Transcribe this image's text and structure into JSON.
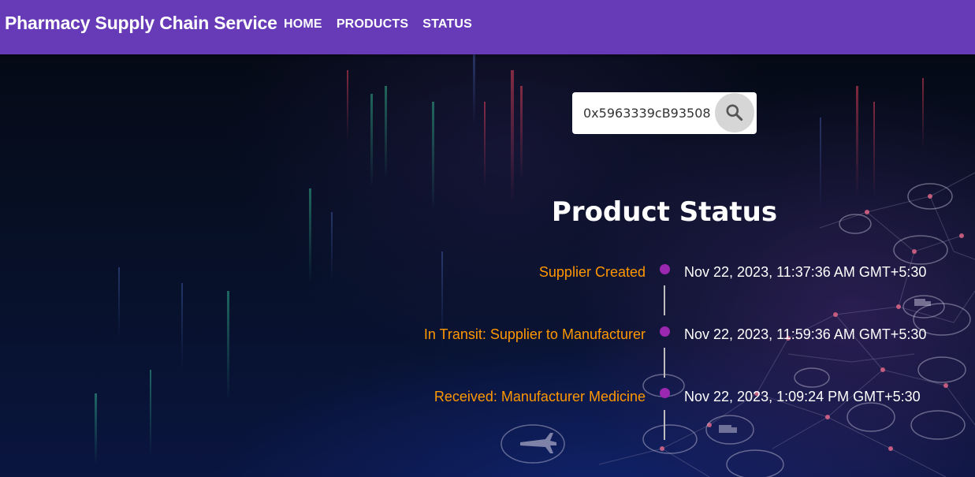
{
  "appbar": {
    "brand": "Pharmacy Supply Chain Service",
    "nav": [
      {
        "label": "HOME"
      },
      {
        "label": "PRODUCTS"
      },
      {
        "label": "STATUS"
      }
    ],
    "color": "#673ab7"
  },
  "search": {
    "value": "0x5963339cB93508",
    "placeholder": "",
    "icon": "search-icon"
  },
  "status": {
    "title": "Product Status",
    "events": [
      {
        "label": "Supplier Created",
        "time": "Nov 22, 2023, 11:37:36 AM GMT+5:30"
      },
      {
        "label": "In Transit: Supplier to Manufacturer",
        "time": "Nov 22, 2023, 11:59:36 AM GMT+5:30"
      },
      {
        "label": "Received: Manufacturer Medicine",
        "time": "Nov 22, 2023, 1:09:24 PM GMT+5:30"
      }
    ],
    "label_color": "#ff9800",
    "dot_color": "#9c27b0"
  }
}
